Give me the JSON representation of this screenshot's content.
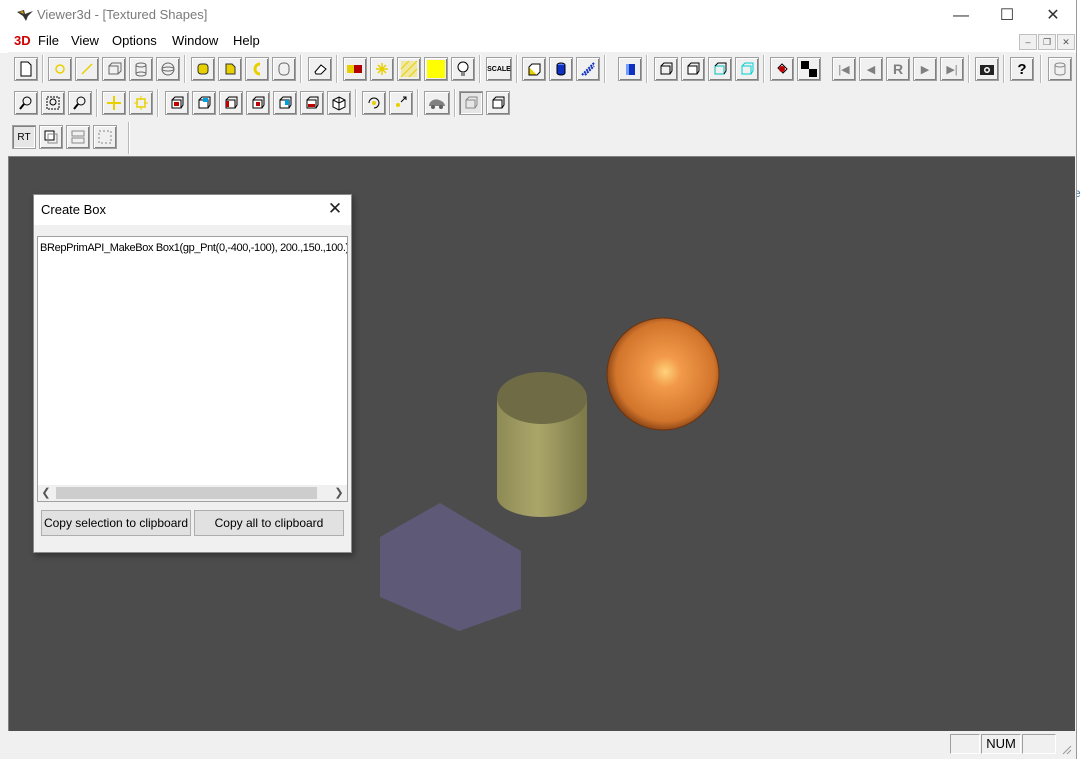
{
  "window": {
    "title": "Viewer3d - [Textured Shapes]"
  },
  "menubar": {
    "logo": "3D",
    "items": [
      "File",
      "View",
      "Options",
      "Window",
      "Help"
    ]
  },
  "toolbar_row3": {
    "rt_label": "RT"
  },
  "toolbar_row1": {
    "scale_label": "SCALE",
    "r_label": "R"
  },
  "dialog": {
    "title": "Create Box",
    "code": "BRepPrimAPI_MakeBox Box1(gp_Pnt(0,-400,-100), 200.,150.,100.);",
    "copy_selection": "Copy selection to clipboard",
    "copy_all": "Copy all to clipboard"
  },
  "statusbar": {
    "num": "NUM"
  },
  "colors": {
    "viewport_bg": "#4c4c4c",
    "cylinder": "#9a9660",
    "sphere": "#d98a3e",
    "box": "#5e5a78"
  }
}
